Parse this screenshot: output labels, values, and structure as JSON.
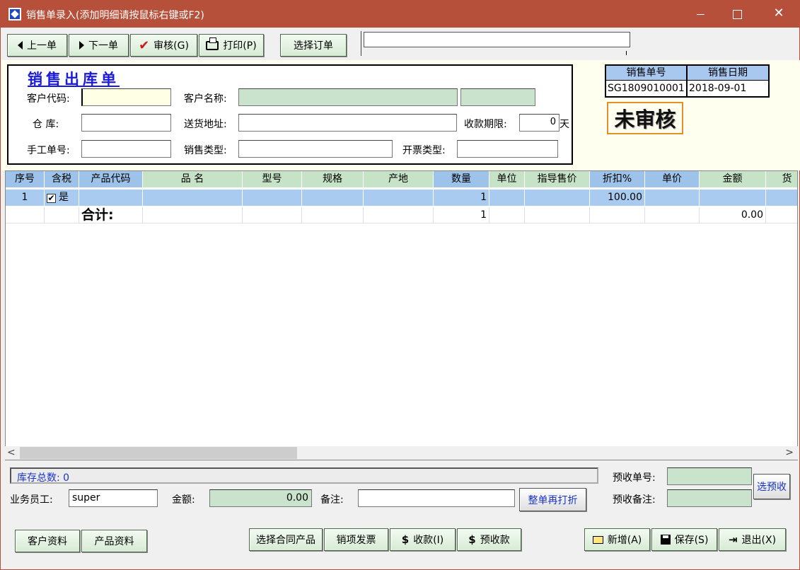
{
  "window": {
    "title": "销售单录入(添加明细请按鼠标右键或F2)"
  },
  "toolbar": {
    "prev": "上一单",
    "next": "下一单",
    "audit": "审核(G)",
    "print": "打印(P)",
    "select_order": "选择订单"
  },
  "form": {
    "title": "销售出库单",
    "customer_code_label": "客户代码:",
    "customer_code_value": "",
    "customer_name_label": "客户名称:",
    "customer_name_value": "",
    "customer_name_extra": "",
    "warehouse_label": "仓 库:",
    "warehouse_value": "",
    "address_label": "送货地址:",
    "address_value": "",
    "payment_term_label": "收款期限:",
    "payment_term_value": "0",
    "payment_term_unit": "天",
    "manual_no_label": "手工单号:",
    "manual_no_value": "",
    "sales_type_label": "销售类型:",
    "sales_type_value": "",
    "invoice_type_label": "开票类型:",
    "invoice_type_value": ""
  },
  "info": {
    "order_no_label": "销售单号",
    "order_date_label": "销售日期",
    "order_no": "SG1809010001",
    "order_date": "2018-09-01",
    "status": "未审核"
  },
  "grid": {
    "columns": [
      "序号",
      "含税",
      "产品代码",
      "品 名",
      "型号",
      "规格",
      "产地",
      "数量",
      "单位",
      "指导售价",
      "折扣%",
      "单价",
      "金额",
      "货"
    ],
    "rows": [
      {
        "seq": "1",
        "tax_checked": "✔",
        "tax": "是",
        "code": "",
        "name": "",
        "model": "",
        "spec": "",
        "origin": "",
        "qty": "1",
        "unit": "",
        "guide_price": "",
        "discount": "100.00",
        "price": "",
        "amount": ""
      }
    ],
    "total": {
      "label": "合计:",
      "qty": "1",
      "amount": "0.00"
    }
  },
  "bottom": {
    "stock_total": "库存总数: 0",
    "salesperson_label": "业务员工:",
    "salesperson_value": "super",
    "amount_label": "金额:",
    "amount_value": "0.00",
    "remark_label": "备注:",
    "remark_value": "",
    "rediscount": "整单再打折",
    "prepay_no_label": "预收单号:",
    "prepay_no_value": "",
    "prepay_remark_label": "预收备注:",
    "prepay_remark_value": "",
    "select_prepay": "选预收"
  },
  "footer": {
    "customer_info": "客户资料",
    "product_info": "产品资料",
    "contract_products": "选择合同产品",
    "sales_invoice": "销项发票",
    "receive": "收款(I)",
    "prepay": "预收款",
    "new": "新增(A)",
    "save": "保存(S)",
    "exit": "退出(X)"
  }
}
